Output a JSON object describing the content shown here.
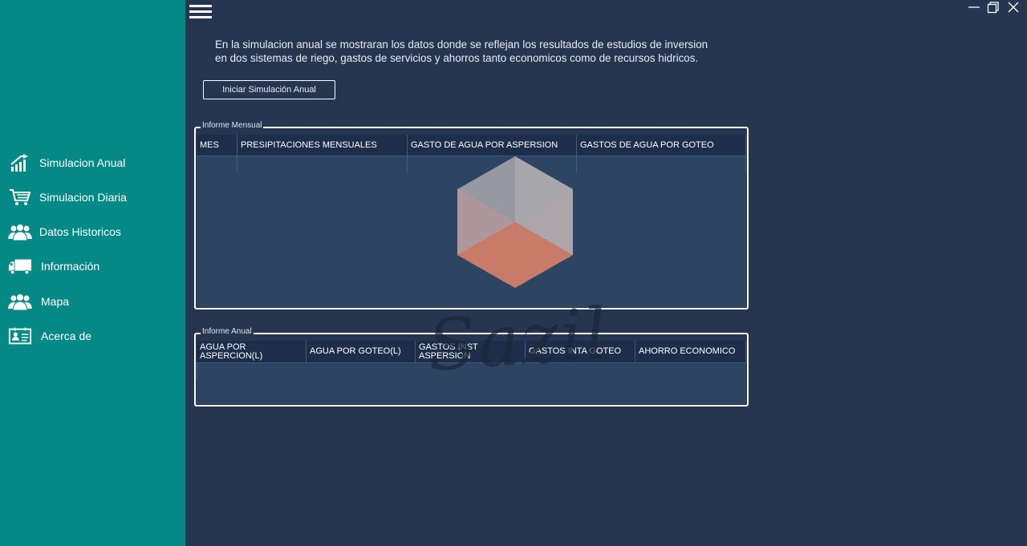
{
  "window": {
    "controls": [
      "minimize-icon",
      "restore-icon",
      "close-icon"
    ]
  },
  "colors": {
    "sidebar": "#058987",
    "background": "#263550",
    "grid_body": "#2e4463",
    "grid_header": "#1d2e4a"
  },
  "sidebar": {
    "items": [
      {
        "label": "Simulacion Anual",
        "icon": "chart-up-icon"
      },
      {
        "label": "Simulacion Diaria",
        "icon": "cart-icon"
      },
      {
        "label": "Datos Historicos",
        "icon": "users-icon"
      },
      {
        "label": "Información",
        "icon": "truck-icon"
      },
      {
        "label": "Mapa",
        "icon": "users-icon"
      },
      {
        "label": "Acerca de",
        "icon": "id-card-icon"
      }
    ]
  },
  "main": {
    "intro_line1": "En la simulacion anual se mostraran los datos donde se reflejan los resultados de estudios de inversion",
    "intro_line2": "en dos sistemas de riego, gastos de servicios y ahorros tanto economicos como de recursos hidricos.",
    "start_button": "Iniciar Simulación Anual",
    "monthly": {
      "title": "Informe Mensual",
      "columns": [
        "MES",
        "PRESIPITACIONES MENSUALES",
        "GASTO DE AGUA POR ASPERSION",
        "GASTOS DE AGUA POR GOTEO"
      ]
    },
    "annual": {
      "title": "Informe Anual",
      "columns": [
        "AGUA POR ASPERCION(L)",
        "AGUA POR GOTEO(L)",
        "GASTOS INST ASPERSION",
        "GASTOS INTA GOTEO",
        "AHORRO ECONOMICO"
      ]
    },
    "watermark": "Sazil"
  }
}
